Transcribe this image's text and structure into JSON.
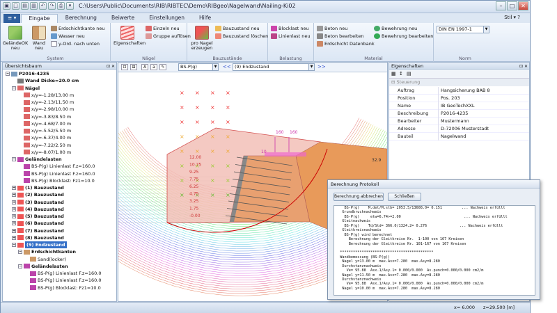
{
  "window": {
    "title": "C:\\Users\\Public\\Documents\\RIB\\RIBTEC\\Demo\\RIBgeo\\Nagelwand\\Nailing-Ki02"
  },
  "tabs": [
    "Eingabe",
    "Berechnung",
    "Beiwerte",
    "Einstellungen",
    "Hilfe"
  ],
  "stil": "Stil",
  "ribbon": {
    "system": {
      "label": "System",
      "big1": "GeländeOK neu",
      "big2": "Wand neu",
      "small": [
        "Erdschichtkante neu",
        "Wasser neu",
        "y-Ord. nach unten"
      ]
    },
    "naegel": {
      "label": "Nägel",
      "big": "Eigenschaften",
      "small": [
        "Einzeln neu",
        "Gruppe auflösen"
      ]
    },
    "bauzustaende": {
      "label": "Bauzustände",
      "big": "pro Nagel erzeugen",
      "small": [
        "Bauzustand neu",
        "Bauzustand löschen"
      ]
    },
    "belastung": {
      "label": "Belastung",
      "small": [
        "Blocklast neu",
        "Linienlast neu"
      ]
    },
    "material": {
      "label": "Material",
      "small": [
        "Beton neu",
        "Beton bearbeiten",
        "Erdschicht Datenbank",
        "Bewehrung neu",
        "Bewehrung bearbeiten"
      ]
    },
    "norm": {
      "label": "Norm",
      "value": "DIN EN 1997-1"
    }
  },
  "overview": {
    "title": "Übersichtsbaum",
    "rows": [
      {
        "t": "P2016-4235",
        "d": 0,
        "b": true,
        "ex": "-"
      },
      {
        "t": "Wand Dicke=20.0 cm",
        "d": 1,
        "b": true
      },
      {
        "t": "Nägel",
        "d": 1,
        "b": true,
        "ex": "-"
      },
      {
        "t": "x/y=-1.28/13.00 m",
        "d": 2
      },
      {
        "t": "x/y=-2.13/11.50 m",
        "d": 2
      },
      {
        "t": "x/y=-2.98/10.00 m",
        "d": 2
      },
      {
        "t": "x/y=-3.83/8.50 m",
        "d": 2
      },
      {
        "t": "x/y=-4.68/7.00 m",
        "d": 2
      },
      {
        "t": "x/y=-5.52/5.50 m",
        "d": 2
      },
      {
        "t": "x/y=-6.37/4.00 m",
        "d": 2
      },
      {
        "t": "x/y=-7.22/2.50 m",
        "d": 2
      },
      {
        "t": "x/y=-8.07/1.00 m",
        "d": 2
      },
      {
        "t": "Geländelasten",
        "d": 1,
        "b": true,
        "ex": "-"
      },
      {
        "t": "BS-P(g) Linienlast F.z=160.0",
        "d": 2
      },
      {
        "t": "BS-P(g) Linienlast F.z=160.0",
        "d": 2
      },
      {
        "t": "BS-P(g) Blocklast: Fz1=10.0",
        "d": 2
      },
      {
        "t": "(1) Bauzustand",
        "d": 1,
        "b": true,
        "ex": "+"
      },
      {
        "t": "(2) Bauzustand",
        "d": 1,
        "b": true,
        "ex": "+"
      },
      {
        "t": "(3) Bauzustand",
        "d": 1,
        "b": true,
        "ex": "+"
      },
      {
        "t": "(4) Bauzustand",
        "d": 1,
        "b": true,
        "ex": "+"
      },
      {
        "t": "(5) Bauzustand",
        "d": 1,
        "b": true,
        "ex": "+"
      },
      {
        "t": "(6) Bauzustand",
        "d": 1,
        "b": true,
        "ex": "+"
      },
      {
        "t": "(7) Bauzustand",
        "d": 1,
        "b": true,
        "ex": "+"
      },
      {
        "t": "(8) Bauzustand",
        "d": 1,
        "b": true,
        "ex": "+"
      },
      {
        "t": "(9) Endzustand",
        "d": 1,
        "b": true,
        "ex": "-",
        "sel": true
      },
      {
        "t": "Erdschichtkanten",
        "d": 2,
        "b": true,
        "ex": "-"
      },
      {
        "t": "Sand(locker)",
        "d": 3
      },
      {
        "t": "Geländelasten",
        "d": 2,
        "b": true,
        "ex": "-"
      },
      {
        "t": "BS-P(g) Linienlast F.z=160.0",
        "d": 3
      },
      {
        "t": "BS-P(g) Linienlast F.z=160.0",
        "d": 3
      },
      {
        "t": "BS-P(g) Blocklast: Fz1=10.0",
        "d": 3
      }
    ]
  },
  "view": {
    "combo1": "BS-P(g)",
    "combo2": "(9) Endzustand",
    "nav_prev": "<<",
    "nav_next": ">>",
    "labels": [
      "12.00",
      "10.75",
      "9.25",
      "7.75",
      "6.25",
      "4.75",
      "3.25",
      "1.75",
      "-0.00"
    ],
    "load_labels": [
      "160",
      "160",
      "10"
    ],
    "right_label": "32.9"
  },
  "properties": {
    "title": "Eigenschaften",
    "section": "Steuerung",
    "rows": [
      [
        "Auftrag",
        "Hangsicherung BAB 8"
      ],
      [
        "Position",
        "Pos. 203"
      ],
      [
        "Name",
        "IB GeoTechXXL"
      ],
      [
        "Beschreibung",
        "P2016-4235"
      ],
      [
        "Bearbeiter",
        "Mustermann"
      ],
      [
        "Adresse",
        "D-72006 Musterstadt"
      ],
      [
        "Bauteil",
        "Nagelwand"
      ]
    ]
  },
  "protocol": {
    "title": "Berechnung Protokoll",
    "btn_abort": "Berechnung abbrechen",
    "btn_close": "Schließen",
    "lines": [
      "    BS-P(g)    M.det/M.stb= 2053.5/13608.0= 0.151         ... Nachweis erfüllt",
      "   Grundbruchnachweis",
      "    BS-P(g)     etw=6.74>=2.00                             ... Nachweis erfüllt",
      "   Gleitnachweis",
      "    BS-P(g)    Td/Std= 366.0/1324.2= 0.276               ... Nachweis erfüllt",
      "   Gleitkreisnachweis",
      "    BS-P(g) wird berechnet",
      "      Berechnung der Gleitkreise Nr.  1-100 von 167 Kreisen",
      "      Berechnung der Gleitkreise Nr. 101-167 von 167 Kreisen",
      "",
      "  *******************************************",
      "  Wandbemessung (BS-P(g))",
      "   Nagel y=13.00 m  max.Asx=7.280  max.Asy=8.280",
      "   Durchstanznachweis",
      "     Ve= 95.88  Asx.1/Asy.1= 0.000/0.000  As.punch=0.000/0.000 cm2/m",
      "   Nagel y=11.50 m  max.Asx=7.280  max.Asy=8.280",
      "   Durchstanznachweis",
      "     Ve= 95.88  Asx.1/Asy.1= 0.000/0.000  As.punch=0.000/0.000 cm2/m",
      "   Nagel y=10.00 m  max.Asx=7.280  max.Asy=8.280"
    ]
  },
  "status": {
    "x": "x= 6.000",
    "z": "z=29.500 [m]"
  },
  "colors": {
    "accent": "#2f5f9e",
    "selection": "#3470c8",
    "wedge": "#f3c0b8",
    "soil": "#e8a070"
  }
}
